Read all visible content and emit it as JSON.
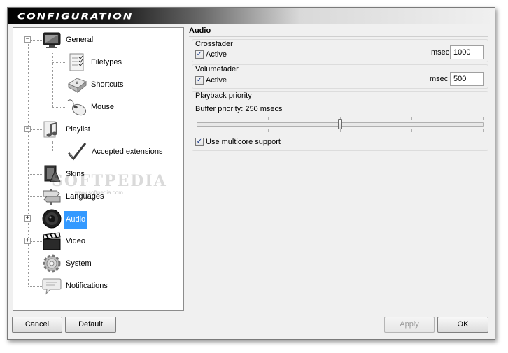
{
  "window": {
    "title": "Configuration"
  },
  "tree": {
    "items": [
      {
        "label": "General",
        "icon": "monitor-icon"
      },
      {
        "label": "Filetypes",
        "icon": "filetypes-list-icon"
      },
      {
        "label": "Shortcuts",
        "icon": "keyboard-key-icon"
      },
      {
        "label": "Mouse",
        "icon": "mouse-icon"
      },
      {
        "label": "Playlist",
        "icon": "music-note-icon"
      },
      {
        "label": "Accepted extensions",
        "icon": "checkmark-icon"
      },
      {
        "label": "Skins",
        "icon": "skins-icon"
      },
      {
        "label": "Languages",
        "icon": "signpost-icon"
      },
      {
        "label": "Audio",
        "icon": "speaker-icon"
      },
      {
        "label": "Video",
        "icon": "clapperboard-icon"
      },
      {
        "label": "System",
        "icon": "gear-icon"
      },
      {
        "label": "Notifications",
        "icon": "speech-bubble-icon"
      }
    ],
    "selected": "Audio"
  },
  "watermark": {
    "text": "SOFTPEDIA",
    "sub": "www.softpedia.com"
  },
  "audio": {
    "section_title": "Audio",
    "crossfader": {
      "title": "Crossfader",
      "active_label": "Active",
      "active_checked": true,
      "msec_label": "msec",
      "msec_value": "1000"
    },
    "volumefader": {
      "title": "Volumefader",
      "active_label": "Active",
      "active_checked": true,
      "msec_label": "msec",
      "msec_value": "500"
    },
    "playback_priority": {
      "title": "Playback priority",
      "buffer_label": "Buffer priority: 250 msecs",
      "buffer_value_msecs": 250,
      "slider_fraction": 0.5,
      "multicore_label": "Use multicore support",
      "multicore_checked": true
    }
  },
  "buttons": {
    "cancel": "Cancel",
    "default": "Default",
    "apply": "Apply",
    "ok": "OK"
  },
  "glyphs": {
    "check": "✓",
    "minus": "−",
    "plus": "+"
  }
}
